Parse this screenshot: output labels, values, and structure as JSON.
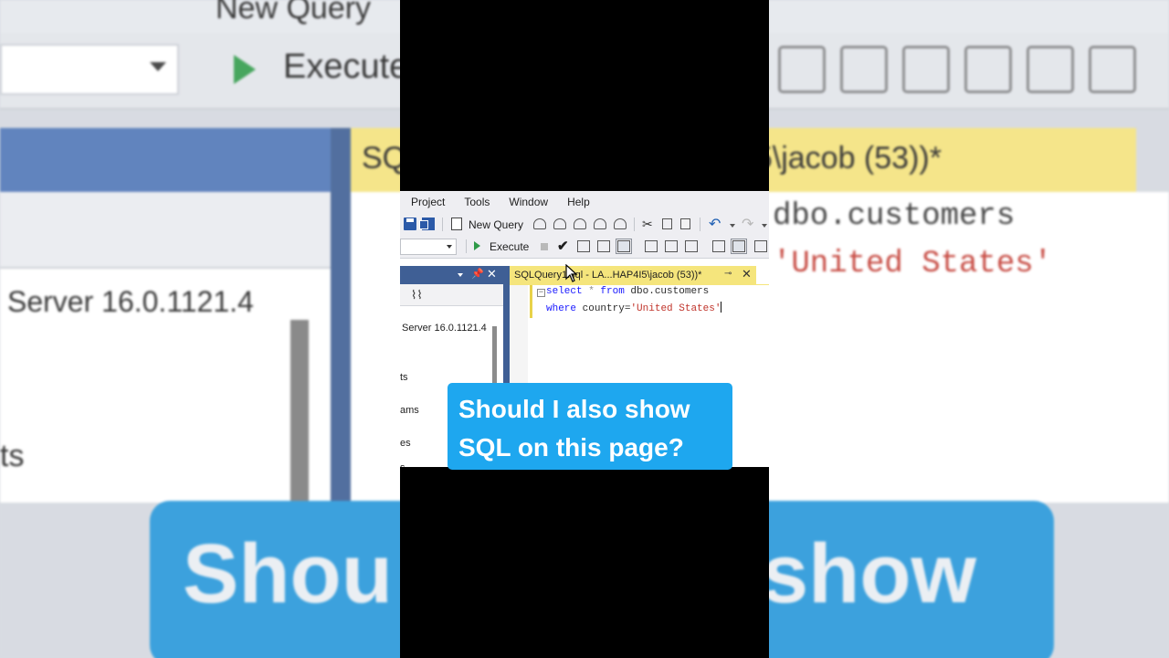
{
  "background": {
    "new_query": "New Query",
    "execute": "Execute",
    "server": "Server 16.0.1121.4",
    "tab_title": "SQLQuery1.sql - LA...HAP4I5\\jacob (53))*",
    "code_line1": "dbo.customers",
    "code_line2": "'United States'",
    "tree_ts": "ts",
    "tree_ams": "ams",
    "banner_left": "Shou",
    "banner_right": "show"
  },
  "menu": [
    "Project",
    "Tools",
    "Window",
    "Help"
  ],
  "toolbar": {
    "new_query_label": "New Query",
    "execute_label": "Execute"
  },
  "object_explorer": {
    "server_node": "Server 16.0.1121.4",
    "nodes": [
      "ts",
      "ams",
      "es",
      "s"
    ]
  },
  "query_tab": {
    "title": "SQLQuery1.sql - LA...HAP4I5\\jacob (53))*"
  },
  "editor": {
    "line1": {
      "kw1": "select",
      "star": " * ",
      "kw2": "from",
      "rest": " dbo.customers"
    },
    "line2": {
      "kw": "where",
      "field": " country=",
      "value": "'United States'"
    }
  },
  "caption": {
    "text": "Should I also show\nSQL on this page?"
  },
  "colors": {
    "caption_bg": "#1ea7ef",
    "tab_bg": "#f5e57c",
    "panel_blue": "#3f5f95",
    "keyword": "#1a1aff",
    "string": "#c0342b"
  }
}
